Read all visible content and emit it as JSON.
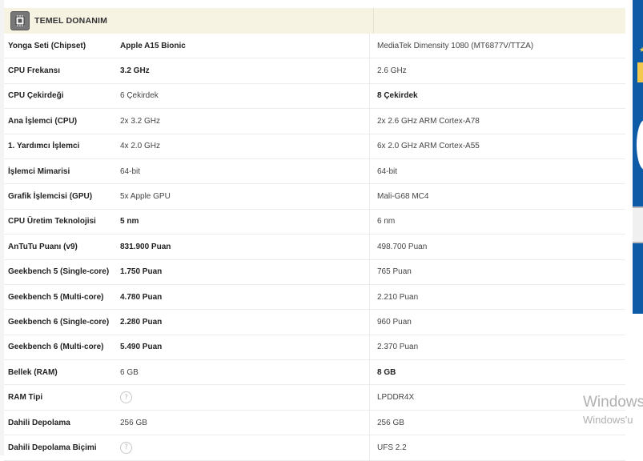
{
  "section": {
    "title": "TEMEL DONANIM",
    "icon": "chip-icon"
  },
  "rows": [
    {
      "label": "Yonga Seti (Chipset)",
      "a": "Apple A15 Bionic",
      "b": "MediaTek Dimensity 1080 (MT6877V/TTZA)",
      "a_bold": true,
      "b_bold": false
    },
    {
      "label": "CPU Frekansı",
      "a": "3.2 GHz",
      "b": "2.6 GHz",
      "a_bold": true,
      "b_bold": false
    },
    {
      "label": "CPU Çekirdeği",
      "a": "6 Çekirdek",
      "b": "8 Çekirdek",
      "a_bold": false,
      "b_bold": true
    },
    {
      "label": "Ana İşlemci (CPU)",
      "a": "2x 3.2 GHz",
      "b": "2x 2.6 GHz ARM Cortex-A78",
      "a_bold": false,
      "b_bold": false
    },
    {
      "label": "1. Yardımcı İşlemci",
      "a": "4x 2.0 GHz",
      "b": "6x 2.0 GHz ARM Cortex-A55",
      "a_bold": false,
      "b_bold": false
    },
    {
      "label": "İşlemci Mimarisi",
      "a": "64-bit",
      "b": "64-bit",
      "a_bold": false,
      "b_bold": false
    },
    {
      "label": "Grafik İşlemcisi (GPU)",
      "a": "5x Apple GPU",
      "b": "Mali-G68 MC4",
      "a_bold": false,
      "b_bold": false
    },
    {
      "label": "CPU Üretim Teknolojisi",
      "a": "5 nm",
      "b": "6 nm",
      "a_bold": true,
      "b_bold": false
    },
    {
      "label": "AnTuTu Puanı (v9)",
      "a": "831.900 Puan",
      "b": "498.700 Puan",
      "a_bold": true,
      "b_bold": false
    },
    {
      "label": "Geekbench 5 (Single-core)",
      "a": "1.750 Puan",
      "b": "765 Puan",
      "a_bold": true,
      "b_bold": false
    },
    {
      "label": "Geekbench 5 (Multi-core)",
      "a": "4.780 Puan",
      "b": "2.210 Puan",
      "a_bold": true,
      "b_bold": false
    },
    {
      "label": "Geekbench 6 (Single-core)",
      "a": "2.280 Puan",
      "b": "960 Puan",
      "a_bold": true,
      "b_bold": false
    },
    {
      "label": "Geekbench 6 (Multi-core)",
      "a": "5.490 Puan",
      "b": "2.370 Puan",
      "a_bold": true,
      "b_bold": false
    },
    {
      "label": "Bellek (RAM)",
      "a": "6 GB",
      "b": "8 GB",
      "a_bold": false,
      "b_bold": true
    },
    {
      "label": "RAM Tipi",
      "a": "",
      "b": "LPDDR4X",
      "a_help": true,
      "a_bold": false,
      "b_bold": false
    },
    {
      "label": "Dahili Depolama",
      "a": "256 GB",
      "b": "256 GB",
      "a_bold": false,
      "b_bold": false
    },
    {
      "label": "Dahili Depolama Biçimi",
      "a": "",
      "b": "UFS 2.2",
      "a_help": true,
      "a_bold": false,
      "b_bold": false
    }
  ],
  "help_icon": "question-circle-icon",
  "help_glyph": "?",
  "watermark": {
    "line1": "Windows",
    "line2": "Windows'u"
  },
  "colors": {
    "header_bg": "#f7f3e3",
    "ad_blue": "#0d5aa7",
    "ad_yellow": "#f2c94c"
  }
}
